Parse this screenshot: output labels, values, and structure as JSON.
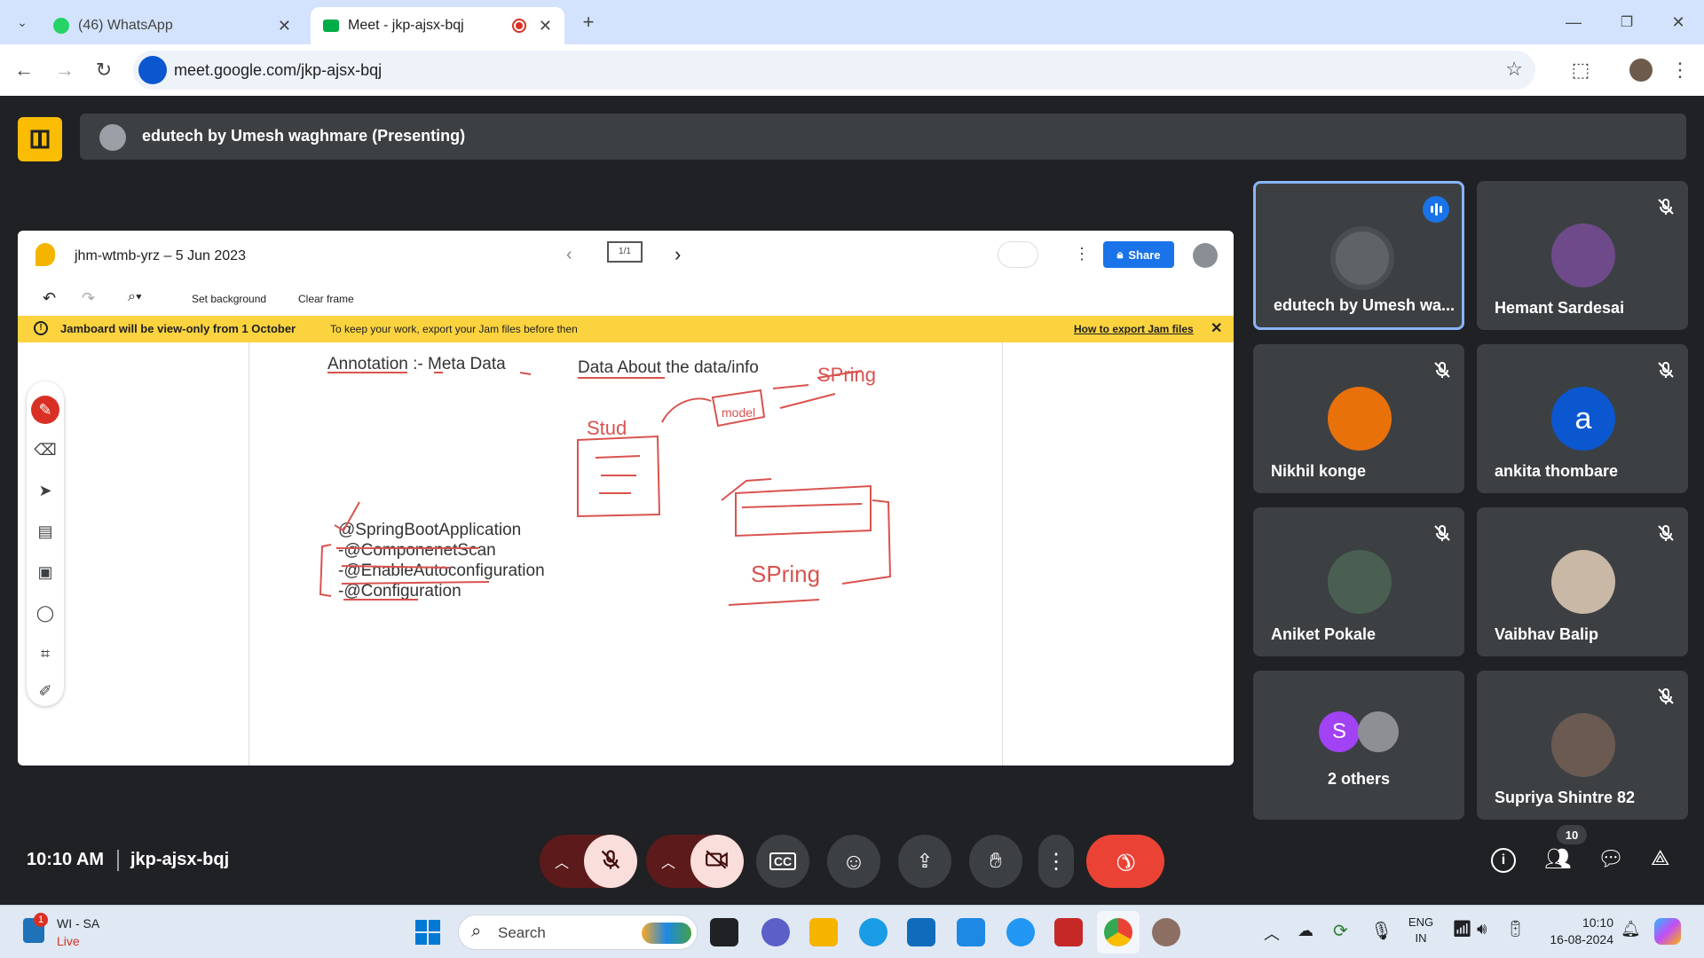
{
  "browser": {
    "tabs": [
      {
        "title": "(46) WhatsApp",
        "active": false
      },
      {
        "title": "Meet - jkp-ajsx-bqj",
        "active": true
      }
    ],
    "url": "meet.google.com/jkp-ajsx-bqj"
  },
  "meet": {
    "presenting_label": "edutech by Umesh waghmare (Presenting)",
    "time": "10:10 AM",
    "meeting_code": "jkp-ajsx-bqj",
    "participant_count": "10",
    "participants": [
      {
        "name": "edutech by Umesh wa...",
        "speaking": true,
        "muted": false
      },
      {
        "name": "Hemant Sardesai",
        "muted": true
      },
      {
        "name": "Nikhil konge",
        "muted": true
      },
      {
        "name": "ankita thombare",
        "muted": true,
        "initial": "a",
        "color": "#0b57d0"
      },
      {
        "name": "Aniket Pokale",
        "muted": true
      },
      {
        "name": "Vaibhav Balip",
        "muted": true
      },
      {
        "name": "2 others",
        "initial": "S",
        "color": "#a142f4"
      },
      {
        "name": "Supriya Shintre 82",
        "muted": true
      }
    ]
  },
  "jamboard": {
    "title": "jhm-wtmb-yrz – 5 Jun 2023",
    "frame_indicator": "1/1",
    "share_label": "Share",
    "toolbar": {
      "set_background": "Set background",
      "clear_frame": "Clear frame"
    },
    "banner": {
      "headline": "Jamboard will be view-only from 1 October",
      "detail": "To keep your work, export your Jam files before then",
      "link": "How to export Jam files"
    },
    "canvas": {
      "annotation_line_left": "Annotation :- Meta Data",
      "annotation_line_right": "Data About the data/info",
      "annotations": [
        "@SpringBootApplication",
        "-@ComponenetScan",
        "-@EnableAutoconfiguration",
        "-@Configuration"
      ],
      "sketch_words": [
        "Stud",
        "model",
        "SPring",
        "SPring"
      ]
    }
  },
  "taskbar": {
    "widget_title": "WI - SA",
    "widget_status": "Live",
    "widget_badge": "1",
    "search_placeholder": "Search",
    "lang": "ENG",
    "region": "IN",
    "clock_time": "10:10",
    "clock_date": "16-08-2024"
  },
  "colors": {
    "accent": "#1a73e8",
    "hangup": "#ea4335",
    "banner": "#fbd33f",
    "meet_bg": "#202124"
  }
}
